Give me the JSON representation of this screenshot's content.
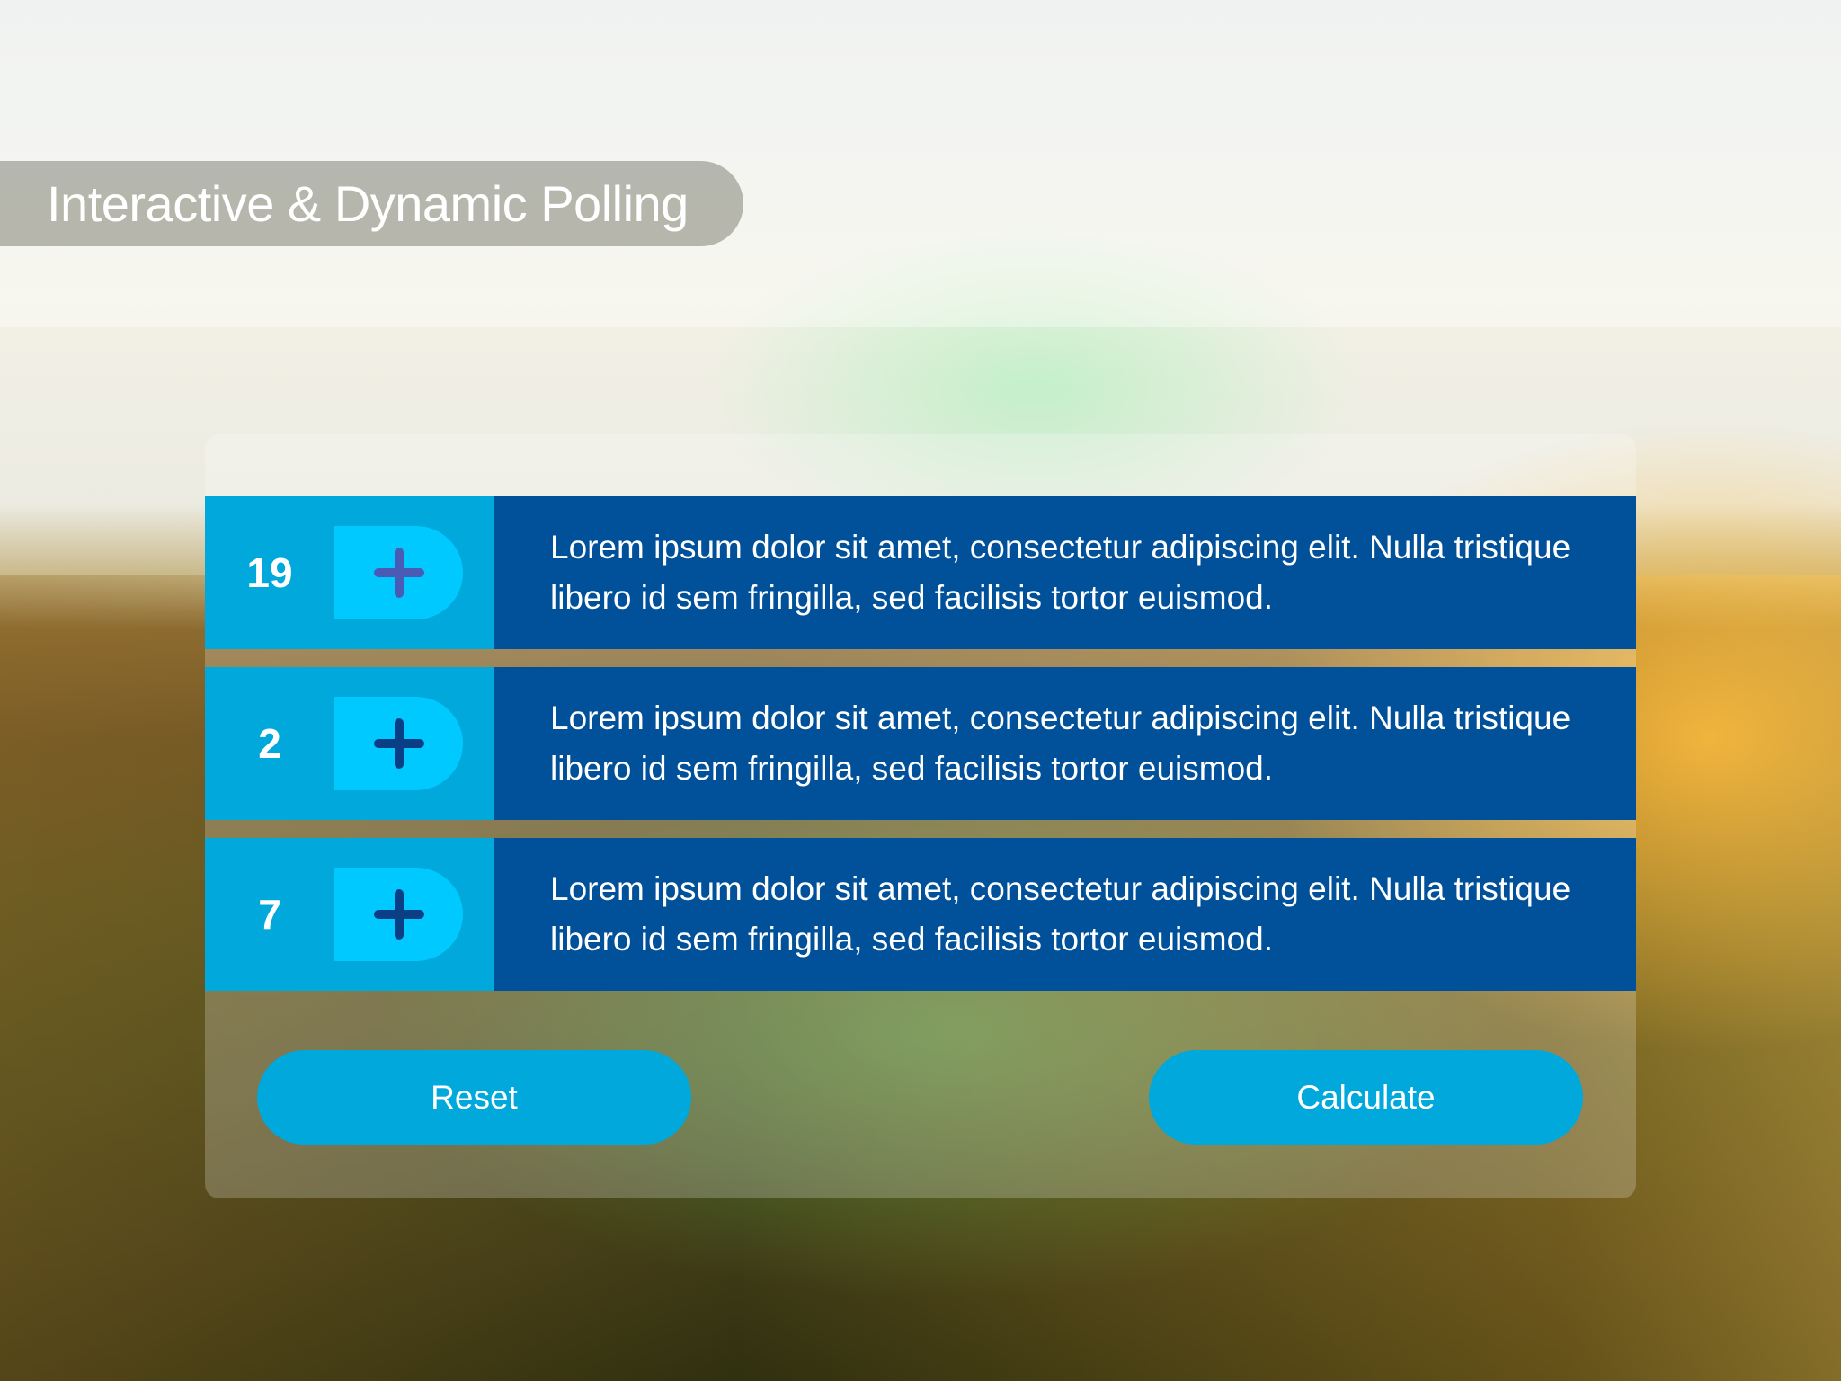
{
  "title": "Interactive & Dynamic Polling",
  "rows": [
    {
      "count": "19",
      "text": "Lorem ipsum dolor sit amet, consectetur adipiscing elit. Nulla tristique libero id sem fringilla, sed facilisis tortor euismod."
    },
    {
      "count": "2",
      "text": "Lorem ipsum dolor sit amet, consectetur adipiscing elit. Nulla tristique libero id sem fringilla, sed facilisis tortor euismod."
    },
    {
      "count": "7",
      "text": "Lorem ipsum dolor sit amet, consectetur adipiscing elit. Nulla tristique libero id sem fringilla, sed facilisis tortor euismod."
    }
  ],
  "buttons": {
    "reset": "Reset",
    "calculate": "Calculate"
  },
  "icons": {
    "row_action": "plus-icon"
  },
  "colors": {
    "count_panel": "#00a8dc",
    "plus_button": "#00c9ff",
    "plus_glyph_first": "#4a5bb5",
    "plus_glyph": "#0a3f86",
    "text_panel": "#00509a",
    "action_button": "#00a8dc"
  }
}
